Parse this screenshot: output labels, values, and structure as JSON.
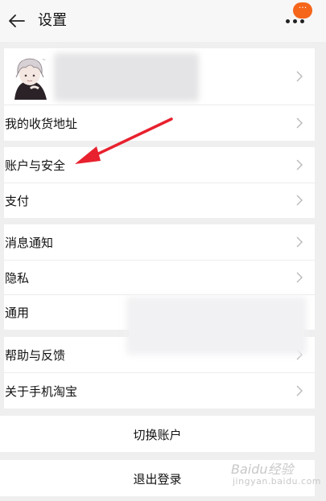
{
  "header": {
    "title": "设置",
    "back_icon": "arrow-left-icon",
    "more_icon": "more-dots-icon",
    "badge_text": "···",
    "badge_color": "#f5651a"
  },
  "profile": {
    "avatar_icon": "anime-avatar"
  },
  "menu": {
    "address": "我的收货地址",
    "account_security": "账户与安全",
    "payment": "支付",
    "notifications": "消息通知",
    "privacy": "隐私",
    "general": "通用",
    "help_feedback": "帮助与反馈",
    "about": "关于手机淘宝"
  },
  "actions": {
    "switch_account": "切换账户",
    "logout": "退出登录"
  },
  "annotation": {
    "arrow_color": "#e8212e",
    "arrow_target": "account_security"
  },
  "watermark": {
    "logo_text": "Baidu经验",
    "url_text": "jingyan.baidu.com"
  }
}
